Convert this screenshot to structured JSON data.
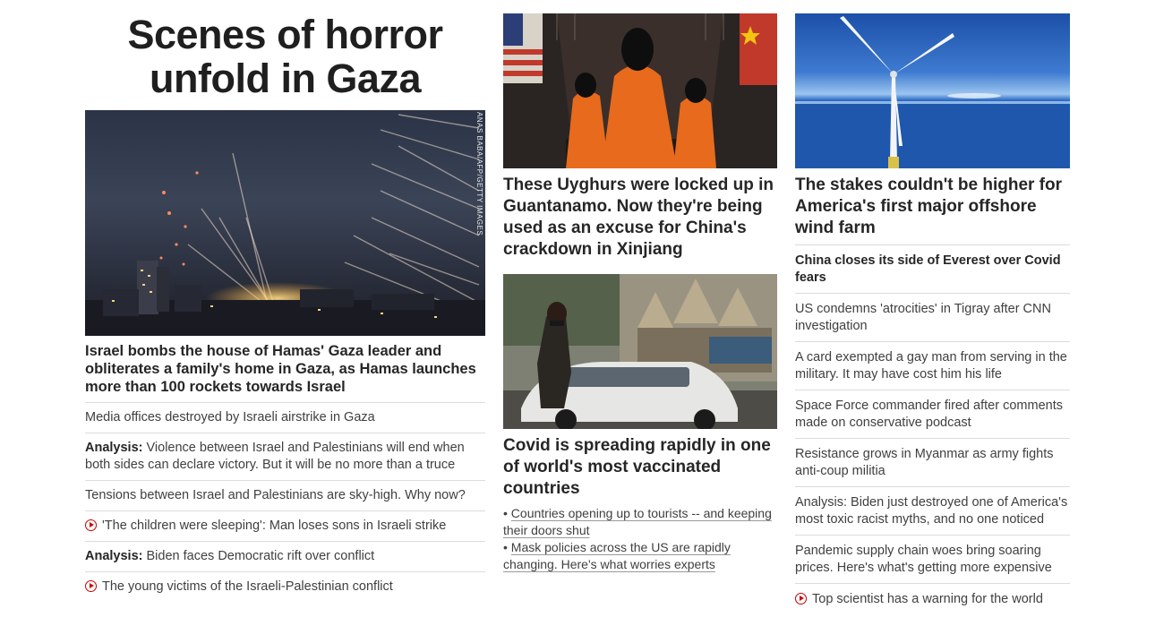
{
  "col1": {
    "banner": "Scenes of horror unfold in Gaza",
    "hero_credit": "ANAS BABA/AFP/GETTY IMAGES",
    "headline": "Israel bombs the house of Hamas' Gaza leader and obliterates a family's home in Gaza, as Hamas launches more than 100 rockets towards Israel",
    "items": [
      {
        "prefix": "",
        "text": "Media offices destroyed by Israeli airstrike in Gaza"
      },
      {
        "prefix": "Analysis:",
        "text": " Violence between Israel and Palestinians will end when both sides can declare victory. But it will be no more than a truce"
      },
      {
        "prefix": "",
        "text": "Tensions between Israel and Palestinians are sky-high. Why now?"
      },
      {
        "prefix": "",
        "text": "'The children were sleeping': Man loses sons in Israeli strike",
        "video": true
      },
      {
        "prefix": "Analysis:",
        "text": " Biden faces Democratic rift over conflict"
      },
      {
        "prefix": "",
        "text": "The young victims of the Israeli-Palestinian conflict",
        "video": true
      }
    ]
  },
  "col2": {
    "headline1": "These Uyghurs were locked up in Guantanamo. Now they're being used as an excuse for China's crackdown in Xinjiang",
    "headline2": "Covid is spreading rapidly in one of world's most vaccinated countries",
    "sublinks": [
      "Countries opening up to tourists -- and keeping their doors shut",
      "Mask policies across the US are rapidly changing. Here's what worries experts"
    ],
    "bullet": "•"
  },
  "col3": {
    "headline": "The stakes couldn't be higher for America's first major offshore wind farm",
    "items": [
      {
        "text": "China closes its side of Everest over Covid fears",
        "strong": true
      },
      {
        "text": "US condemns 'atrocities' in Tigray after CNN investigation"
      },
      {
        "text": "A card exempted a gay man from serving in the military. It may have cost him his life"
      },
      {
        "text": "Space Force commander fired after comments made on conservative podcast"
      },
      {
        "text": "Resistance grows in Myanmar as army fights anti-coup militia"
      },
      {
        "text": "Analysis: Biden just destroyed one of America's most toxic racist myths, and no one noticed"
      },
      {
        "text": "Pandemic supply chain woes bring soaring prices. Here's what's getting more expensive"
      },
      {
        "text": "Top scientist has a warning for the world",
        "video": true
      }
    ]
  },
  "colors": {
    "video_icon": "#cc0000",
    "divider": "#dcdcdc",
    "headline_text": "#262626"
  }
}
